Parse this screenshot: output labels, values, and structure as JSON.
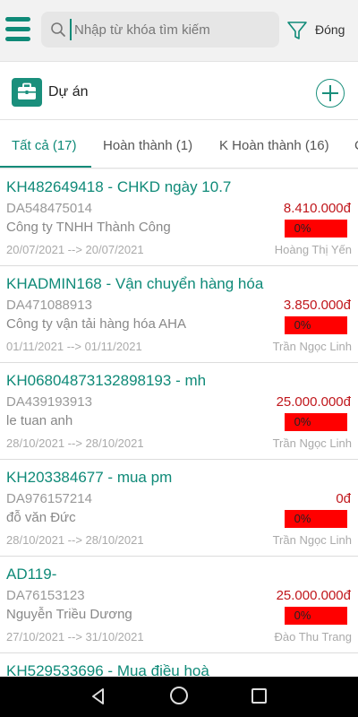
{
  "search": {
    "placeholder": "Nhập từ khóa tìm kiếm",
    "close_label": "Đóng"
  },
  "header": {
    "title": "Dự án",
    "add_icon": "plus-circle-icon",
    "section_icon": "briefcase-icon"
  },
  "tabs": [
    {
      "label": "Tất cả (17)",
      "active": true
    },
    {
      "label": "Hoàn thành (1)",
      "active": false
    },
    {
      "label": "K Hoàn thành (16)",
      "active": false
    },
    {
      "label": "C",
      "active": false
    }
  ],
  "projects": [
    {
      "code": "KH482649418 - CHKD ngày 10.7",
      "da": "DA548475014",
      "customer": "Công ty TNHH Thành Công",
      "dates": "20/07/2021  --> 20/07/2021",
      "amount": "8.410.000đ",
      "progress": "0%",
      "owner": "Hoàng Thị Yến"
    },
    {
      "code": "KHADMIN168 - Vận chuyển hàng hóa",
      "da": "DA471088913",
      "customer": "Công ty vận tải hàng hóa AHA",
      "dates": "01/11/2021  --> 01/11/2021",
      "amount": "3.850.000đ",
      "progress": "0%",
      "owner": "Trần Ngọc Linh"
    },
    {
      "code": "KH06804873132898193 - mh",
      "da": "DA439193913",
      "customer": "le tuan anh",
      "dates": "28/10/2021  --> 28/10/2021",
      "amount": "25.000.000đ",
      "progress": "0%",
      "owner": "Trần Ngọc Linh"
    },
    {
      "code": "KH203384677 - mua pm",
      "da": "DA976157214",
      "customer": "đỗ văn Đức",
      "dates": "28/10/2021  --> 28/10/2021",
      "amount": "0đ",
      "progress": "0%",
      "owner": "Trần Ngọc Linh"
    },
    {
      "code": "AD119-",
      "da": "DA76153123",
      "customer": "Nguyễn Triều Dương",
      "dates": "27/10/2021  --> 31/10/2021",
      "amount": "25.000.000đ",
      "progress": "0%",
      "owner": "Đào Thu Trang"
    },
    {
      "code": "KH529533696 - Mua điều hoà",
      "da": "",
      "customer": "",
      "dates": "",
      "amount": "",
      "progress": "",
      "owner": ""
    }
  ],
  "colors": {
    "accent": "#0f8a78",
    "amount": "#c0161b",
    "progress_bar": "#ff0000"
  },
  "system_nav": [
    "back-icon",
    "home-icon",
    "recents-icon"
  ]
}
